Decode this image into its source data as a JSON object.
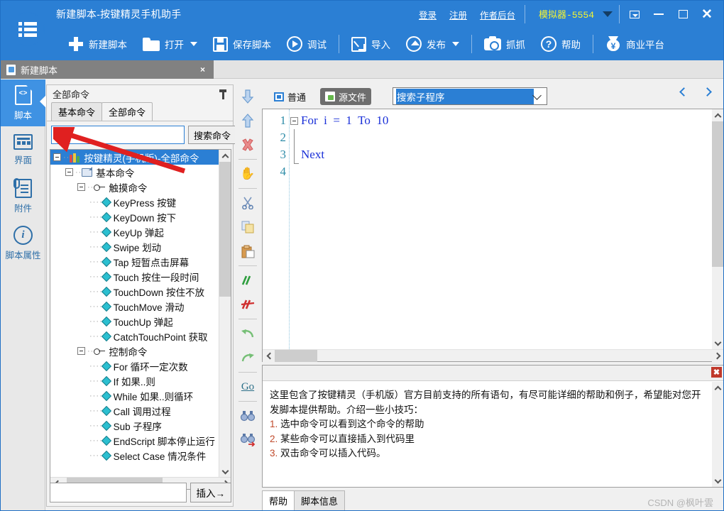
{
  "window": {
    "title": "新建脚本-按键精灵手机助手",
    "menu_icon": "hamburger-menu-icon",
    "links": [
      {
        "label": "登录",
        "name": "login-link"
      },
      {
        "label": "注册",
        "name": "register-link"
      },
      {
        "label": "作者后台",
        "name": "author-backend-link"
      }
    ],
    "emulator": {
      "label": "模拟器-5554",
      "caret": "chevron-down-icon"
    },
    "controls": {
      "restore_small": "restore-small-icon",
      "minimize": "minimize-icon",
      "maximize": "maximize-icon",
      "close": "close-icon"
    },
    "accent_color": "#2b7fd4",
    "emulator_color": "#f5f530"
  },
  "ribbon": {
    "items": [
      {
        "label": "新建脚本",
        "icon": "plus-icon",
        "name": "new-script-button",
        "caret": false
      },
      {
        "label": "打开",
        "icon": "folder-icon",
        "name": "open-button",
        "caret": true
      },
      {
        "label": "保存脚本",
        "icon": "save-icon",
        "name": "save-script-button",
        "caret": false
      },
      {
        "label": "调试",
        "icon": "play-icon",
        "name": "debug-button",
        "caret": false
      },
      {
        "label": "导入",
        "icon": "import-icon",
        "name": "import-button",
        "caret": false
      },
      {
        "label": "发布",
        "icon": "publish-icon",
        "name": "publish-button",
        "caret": true
      },
      {
        "label": "抓抓",
        "icon": "camera-icon",
        "name": "capture-button",
        "caret": false
      },
      {
        "label": "帮助",
        "icon": "help-icon",
        "name": "help-button",
        "caret": false
      },
      {
        "label": "商业平台",
        "icon": "money-bag-icon",
        "name": "commercial-platform-button",
        "caret": false
      }
    ]
  },
  "doc_tab": {
    "label": "新建脚本",
    "close": "×",
    "icon": "script-file-icon"
  },
  "rail": {
    "items": [
      {
        "label": "脚本",
        "icon": "script-code-icon",
        "active": true,
        "name": "sidebar-item-script"
      },
      {
        "label": "界面",
        "icon": "ui-grid-icon",
        "active": false,
        "name": "sidebar-item-ui"
      },
      {
        "label": "附件",
        "icon": "attachment-icon",
        "active": false,
        "name": "sidebar-item-attachment"
      },
      {
        "label": "脚本属性",
        "icon": "info-icon",
        "active": false,
        "name": "sidebar-item-script-properties"
      }
    ]
  },
  "command_panel": {
    "header": "全部命令",
    "pin_icon": "pin-icon",
    "tabs": [
      {
        "label": "基本命令",
        "active": false
      },
      {
        "label": "全部命令",
        "active": true
      }
    ],
    "search_value": "??",
    "search_button": "搜索命令",
    "insert_input_value": "",
    "insert_button": "插入→",
    "tree": [
      {
        "level": 0,
        "label": "按键精灵(手机版)-全部命令",
        "icon": "books-icon",
        "toggle": true,
        "selected": true
      },
      {
        "level": 1,
        "label": "基本命令",
        "icon": "folder-icon",
        "toggle": true,
        "selected": false
      },
      {
        "level": 2,
        "label": "触摸命令",
        "icon": "link-icon",
        "toggle": true,
        "selected": false
      },
      {
        "level": 3,
        "label": "KeyPress 按键",
        "icon": "diamond-icon",
        "toggle": false,
        "selected": false
      },
      {
        "level": 3,
        "label": "KeyDown 按下",
        "icon": "diamond-icon",
        "toggle": false,
        "selected": false
      },
      {
        "level": 3,
        "label": "KeyUp 弹起",
        "icon": "diamond-icon",
        "toggle": false,
        "selected": false
      },
      {
        "level": 3,
        "label": "Swipe 划动",
        "icon": "diamond-icon",
        "toggle": false,
        "selected": false
      },
      {
        "level": 3,
        "label": "Tap 短暂点击屏幕",
        "icon": "diamond-icon",
        "toggle": false,
        "selected": false
      },
      {
        "level": 3,
        "label": "Touch 按住一段时间",
        "icon": "diamond-icon",
        "toggle": false,
        "selected": false
      },
      {
        "level": 3,
        "label": "TouchDown 按住不放",
        "icon": "diamond-icon",
        "toggle": false,
        "selected": false
      },
      {
        "level": 3,
        "label": "TouchMove 滑动",
        "icon": "diamond-icon",
        "toggle": false,
        "selected": false
      },
      {
        "level": 3,
        "label": "TouchUp 弹起",
        "icon": "diamond-icon",
        "toggle": false,
        "selected": false
      },
      {
        "level": 3,
        "label": "CatchTouchPoint 获取",
        "icon": "diamond-icon",
        "toggle": false,
        "selected": false
      },
      {
        "level": 2,
        "label": "控制命令",
        "icon": "link-icon",
        "toggle": true,
        "selected": false
      },
      {
        "level": 3,
        "label": "For 循环一定次数",
        "icon": "diamond-icon",
        "toggle": false,
        "selected": false
      },
      {
        "level": 3,
        "label": "If 如果..则",
        "icon": "diamond-icon",
        "toggle": false,
        "selected": false
      },
      {
        "level": 3,
        "label": "While 如果..则循环",
        "icon": "diamond-icon",
        "toggle": false,
        "selected": false
      },
      {
        "level": 3,
        "label": "Call 调用过程",
        "icon": "diamond-icon",
        "toggle": false,
        "selected": false
      },
      {
        "level": 3,
        "label": "Sub 子程序",
        "icon": "diamond-icon",
        "toggle": false,
        "selected": false
      },
      {
        "level": 3,
        "label": "EndScript 脚本停止运行",
        "icon": "diamond-icon",
        "toggle": false,
        "selected": false
      },
      {
        "level": 3,
        "label": "Select Case 情况条件",
        "icon": "diamond-icon",
        "toggle": false,
        "selected": false
      }
    ]
  },
  "vtoolbar": {
    "items": [
      {
        "icon": "move-down-icon",
        "name": "move-down-button"
      },
      {
        "icon": "move-up-icon",
        "name": "move-up-button"
      },
      {
        "icon": "delete-icon",
        "name": "delete-button"
      },
      {
        "divider": true
      },
      {
        "icon": "hand-icon",
        "name": "hand-button"
      },
      {
        "divider": true
      },
      {
        "icon": "scissors-icon",
        "name": "cut-button"
      },
      {
        "icon": "copy-icon",
        "name": "copy-button"
      },
      {
        "icon": "paste-icon",
        "name": "paste-button"
      },
      {
        "divider": true
      },
      {
        "icon": "comment-icon",
        "name": "comment-button"
      },
      {
        "icon": "uncomment-icon",
        "name": "uncomment-button"
      },
      {
        "divider": true
      },
      {
        "icon": "undo-icon",
        "name": "undo-button"
      },
      {
        "icon": "redo-icon",
        "name": "redo-button"
      },
      {
        "divider": true
      },
      {
        "icon": "goto-icon",
        "name": "goto-button"
      },
      {
        "divider": true
      },
      {
        "icon": "find-icon",
        "name": "find-button"
      },
      {
        "icon": "find-replace-icon",
        "name": "find-replace-button"
      }
    ]
  },
  "editor": {
    "mode_normal": "普通",
    "mode_source": "源文件",
    "sub_search_value": "搜索子程序",
    "nav_prev": "prev-icon",
    "nav_next": "next-icon",
    "lines": [
      {
        "no": "1",
        "text": "For  i  =  1  To  10",
        "fold": true
      },
      {
        "no": "2",
        "text": "",
        "fold": false
      },
      {
        "no": "3",
        "text": "Next",
        "fold": false
      },
      {
        "no": "4",
        "text": "",
        "fold": false
      }
    ]
  },
  "help": {
    "close": "✖",
    "paragraph": "这里包含了按键精灵（手机版）官方目前支持的所有语句，有尽可能详细的帮助和例子，希望能对您开发脚本提供帮助。介绍一些小技巧：",
    "tips": [
      {
        "num": "1.",
        "text": "选中命令可以看到这个命令的帮助"
      },
      {
        "num": "2.",
        "text": "某些命令可以直接插入到代码里"
      },
      {
        "num": "3.",
        "text": "双击命令可以插入代码。"
      }
    ]
  },
  "bottom_tabs": [
    {
      "label": "帮助",
      "active": false,
      "name": "tab-help"
    },
    {
      "label": "脚本信息",
      "active": true,
      "name": "tab-script-info"
    }
  ],
  "watermark": "CSDN @枫叶雲"
}
